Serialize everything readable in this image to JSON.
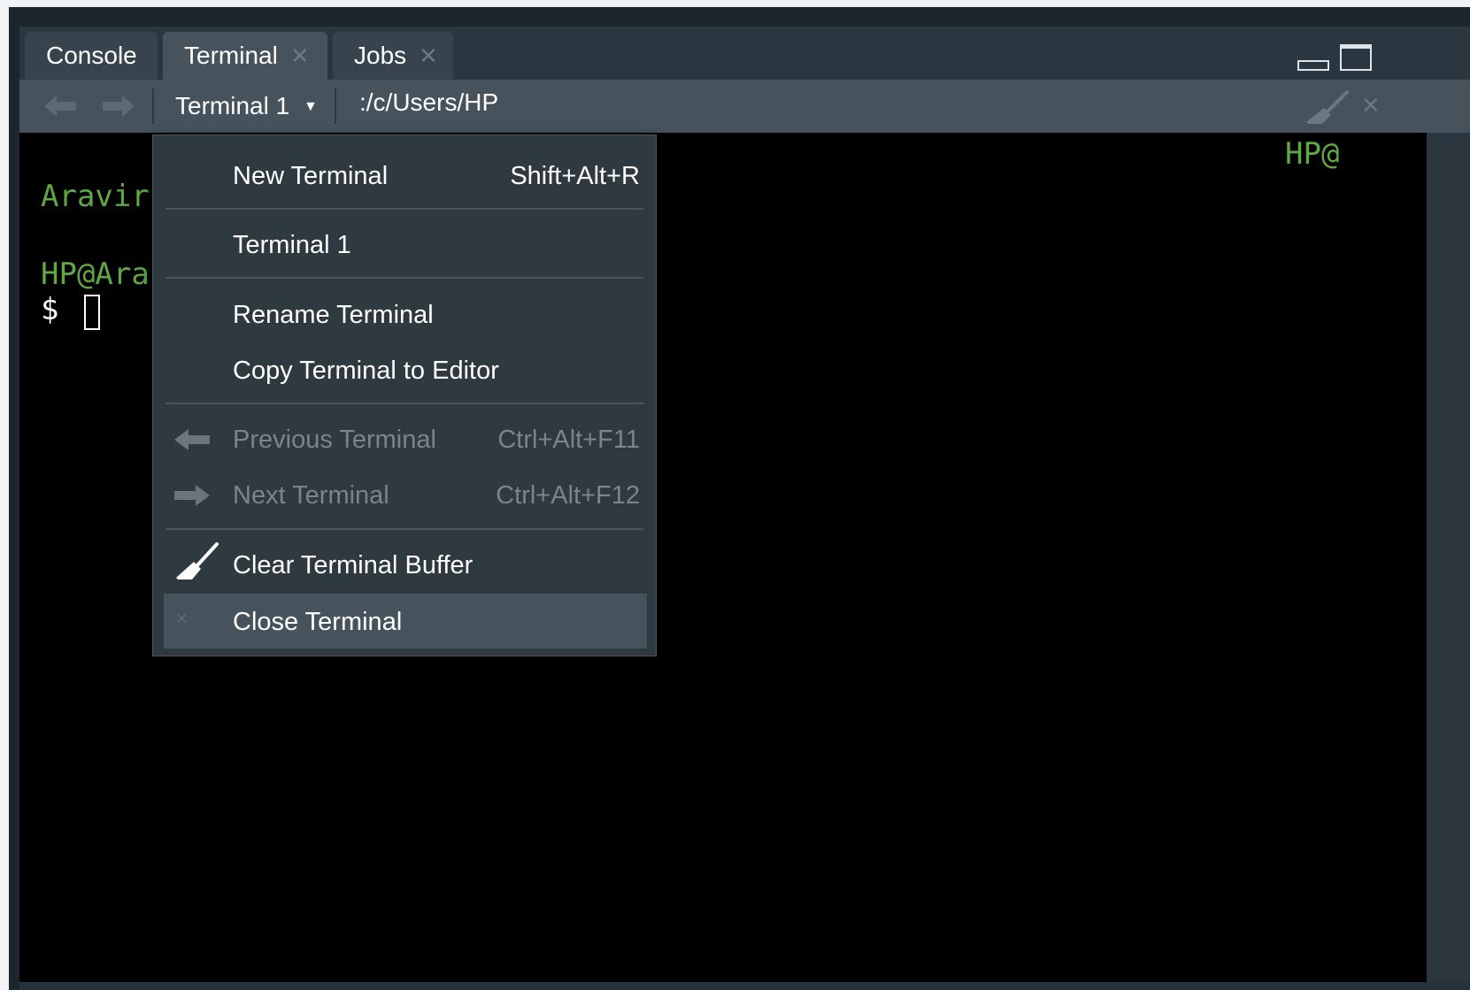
{
  "tabs": [
    {
      "label": "Console",
      "closable": false
    },
    {
      "label": "Terminal",
      "closable": true,
      "active": true
    },
    {
      "label": "Jobs",
      "closable": true
    }
  ],
  "toolbar": {
    "terminal_selector": "Terminal 1",
    "path": ":/c/Users/HP"
  },
  "terminal": {
    "line1": "Aravir",
    "line2": "HP@Ara",
    "prompt": "$",
    "right_fragment": "HP@"
  },
  "menu": {
    "new_terminal": {
      "label": "New Terminal",
      "shortcut": "Shift+Alt+R"
    },
    "terminal_1": {
      "label": "Terminal 1"
    },
    "rename": {
      "label": "Rename Terminal"
    },
    "copy_to_editor": {
      "label": "Copy Terminal to Editor"
    },
    "previous": {
      "label": "Previous Terminal",
      "shortcut": "Ctrl+Alt+F11"
    },
    "next": {
      "label": "Next Terminal",
      "shortcut": "Ctrl+Alt+F12"
    },
    "clear_buffer": {
      "label": "Clear Terminal Buffer"
    },
    "close": {
      "label": "Close Terminal"
    }
  },
  "icons": {
    "tab_close": "close-icon",
    "back": "arrow-left-icon",
    "forward": "arrow-right-icon",
    "dropdown": "caret-down-icon",
    "broom": "broom-icon",
    "minimize": "minimize-icon",
    "maximize": "maximize-icon"
  },
  "colors": {
    "terminal_green": "#5fa843",
    "terminal_bg": "#000000",
    "menu_bg": "#2e3940",
    "menu_highlight": "#46535d",
    "disabled_text": "#7a848b"
  }
}
